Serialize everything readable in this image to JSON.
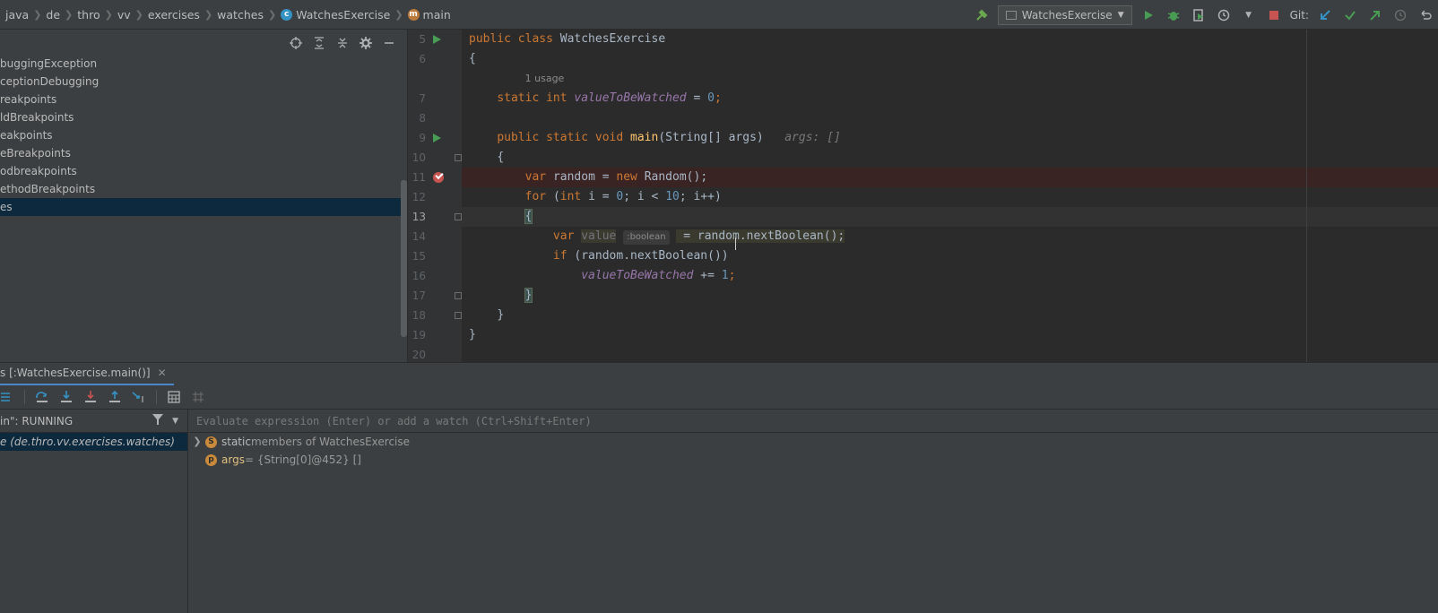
{
  "breadcrumbs": [
    "java",
    "de",
    "thro",
    "vv",
    "exercises",
    "watches",
    "WatchesExercise",
    "main"
  ],
  "toolbar": {
    "run_config": "WatchesExercise",
    "git_label": "Git:",
    "icons": [
      "hammer-icon",
      "run-icon",
      "debug-icon",
      "coverage-icon",
      "profile-icon",
      "stop-icon",
      "git-update-icon",
      "git-commit-icon",
      "git-push-icon",
      "history-icon",
      "rollback-icon"
    ]
  },
  "project_tree": [
    "buggingException",
    "ceptionDebugging",
    "reakpoints",
    "ldBreakpoints",
    "eakpoints",
    "eBreakpoints",
    "odbreakpoints",
    "ethodBreakpoints",
    "es"
  ],
  "editor": {
    "line_numbers": [
      "5",
      "6",
      "",
      "7",
      "8",
      "9",
      "10",
      "11",
      "12",
      "13",
      "14",
      "15",
      "16",
      "17",
      "18",
      "19",
      "20"
    ],
    "usage_hint": "1 usage",
    "args_hint": "args: []",
    "type_hint": ":boolean",
    "code": {
      "l5_a": "public class ",
      "l5_b": "WatchesExercise",
      "l6": "{",
      "l7_kw": "static int ",
      "l7_field": "valueToBeWatched",
      "l7_eq": " = ",
      "l7_num": "0",
      "l7_end": ";",
      "l9_kw": "public static void ",
      "l9_fn": "main",
      "l9_rest": "(String[] args)",
      "l10": "{",
      "l11_kw": "var ",
      "l11_a": "random = ",
      "l11_kw2": "new ",
      "l11_b": "Random();",
      "l12_kw": "for ",
      "l12_a": "(",
      "l12_kw2": "int ",
      "l12_b": "i = ",
      "l12_n1": "0",
      "l12_c": "; i < ",
      "l12_n2": "10",
      "l12_d": "; i++)",
      "l13": "{",
      "l14_kw": "var ",
      "l14_var": "value",
      "l14_rest": " = random.nextBoolean();",
      "l15_kw": "if ",
      "l15_rest": "(random.nextBoolean())",
      "l16_field": "valueToBeWatched",
      "l16_a": " += ",
      "l16_num": "1",
      "l16_end": ";",
      "l17": "}",
      "l18": "}",
      "l19": "}"
    }
  },
  "debug": {
    "tab_label": "s [:WatchesExercise.main()]",
    "thread_status": "in\": RUNNING",
    "frame_selected": "e (de.thro.vv.exercises.watches)",
    "eval_placeholder": "Evaluate expression (Enter) or add a watch (Ctrl+Shift+Enter)",
    "variables": [
      {
        "icon": "S",
        "name": "static",
        "value": " members of WatchesExercise"
      },
      {
        "icon": "p",
        "name": "args",
        "value": " = {String[0]@452} []"
      }
    ]
  }
}
